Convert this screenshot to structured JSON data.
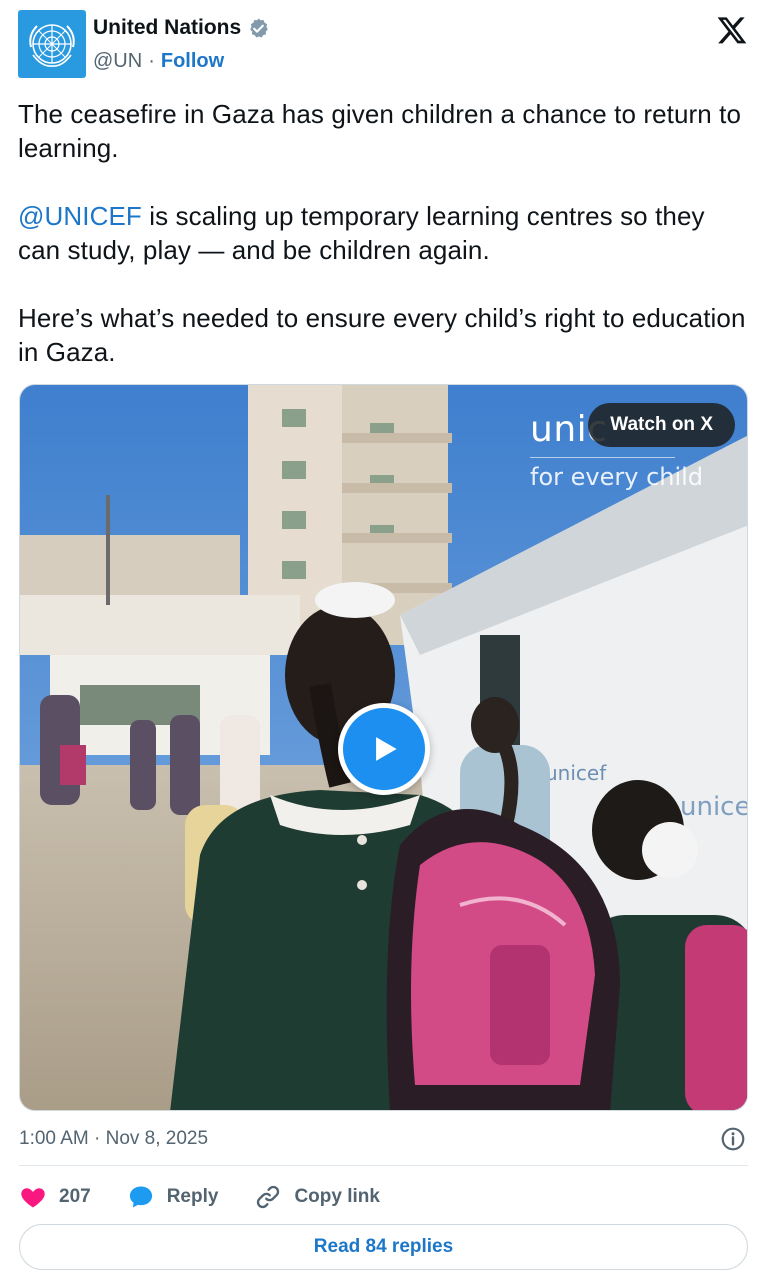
{
  "author": {
    "display_name": "United Nations",
    "handle": "@UN",
    "separator": "·",
    "follow_label": "Follow",
    "avatar_color": "#2a9ae0",
    "verified_icon": "verified-badge-icon"
  },
  "tweet": {
    "paragraph1": "The ceasefire in Gaza has given children a chance to return to learning.",
    "mention": "@UNICEF",
    "paragraph2_rest": " is scaling up temporary learning centres so they can study, play — and be children again.",
    "paragraph3": "Here’s what’s needed to ensure every child’s right to education in Gaza."
  },
  "media": {
    "watch_label": "Watch on X",
    "brand_word": "unic",
    "brand_tagline": "for every child",
    "tent_logo_text": "unicef",
    "play_icon": "play-icon"
  },
  "meta": {
    "timestamp": "1:00 AM · Nov 8, 2025",
    "info_icon": "info-icon"
  },
  "actions": {
    "like_count": "207",
    "reply_label": "Reply",
    "copy_label": "Copy link",
    "read_replies_label": "Read 84 replies"
  },
  "colors": {
    "link_blue": "#1d77c9",
    "like_pink": "#f91880",
    "reply_blue": "#1d9bf0",
    "muted": "#536471"
  }
}
